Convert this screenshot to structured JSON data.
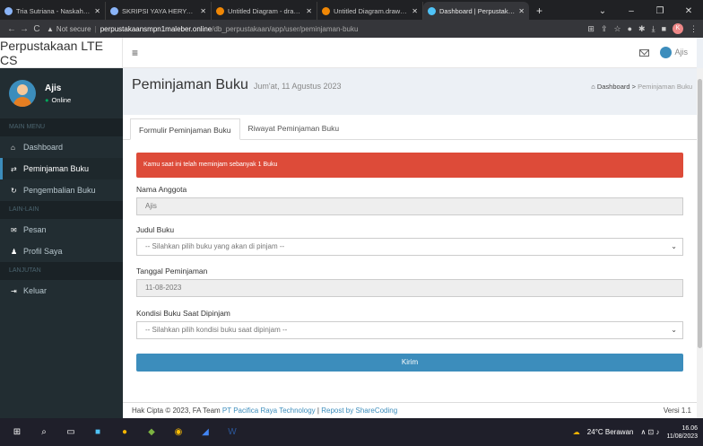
{
  "browser": {
    "tabs": [
      {
        "title": "Tria Sutriana - Naskah Skripsi",
        "favicon_color": "#8ab4f8",
        "active": false
      },
      {
        "title": "SKRIPSI YAYA HERYANA.pdf",
        "favicon_color": "#8ab4f8",
        "active": false
      },
      {
        "title": "Untitled Diagram - draw.io",
        "favicon_color": "#f08705",
        "active": false
      },
      {
        "title": "Untitled Diagram.drawio - di",
        "favicon_color": "#f08705",
        "active": false
      },
      {
        "title": "Dashboard | Perpustakaan SI",
        "favicon_color": "#4fc3f7",
        "active": true
      }
    ],
    "new_tab": "+",
    "address": {
      "security": "Not secure",
      "host": "perpustakaansmpn1maleber.online",
      "path": "/db_perpustakaan/app/user/peminjaman-buku"
    },
    "profile_initial": "K"
  },
  "app": {
    "logo": "Perpustakaan LTE CS",
    "user_name": "Ajis",
    "user_status": "Online"
  },
  "sidebar": {
    "main_header": "MAIN MENU",
    "items": [
      {
        "label": "Dashboard",
        "icon": "home-icon"
      },
      {
        "label": "Peminjaman Buku",
        "icon": "exchange-icon"
      },
      {
        "label": "Pengembalian Buku",
        "icon": "refresh-icon"
      }
    ],
    "other_header": "LAIN-LAIN",
    "other_items": [
      {
        "label": "Pesan",
        "icon": "envelope-icon"
      },
      {
        "label": "Profil Saya",
        "icon": "user-icon"
      }
    ],
    "more_header": "LANJUTAN",
    "more_items": [
      {
        "label": "Keluar",
        "icon": "sign-out-icon"
      }
    ]
  },
  "page": {
    "title": "Peminjaman Buku",
    "subtitle": "Jum'at, 11 Agustus 2023",
    "breadcrumb_home": "Dashboard",
    "breadcrumb_sep": ">",
    "breadcrumb_current": "Peminjaman Buku"
  },
  "form": {
    "tabs": [
      "Formulir Peminjaman Buku",
      "Riwayat Peminjaman Buku"
    ],
    "alert": "Kamu saat ini telah meminjam sebanyak 1 Buku",
    "nama_label": "Nama Anggota",
    "nama_value": "Ajis",
    "judul_label": "Judul Buku",
    "judul_placeholder": "-- Silahkan pilih buku yang akan di pinjam --",
    "tanggal_label": "Tanggal Peminjaman",
    "tanggal_value": "11-08-2023",
    "kondisi_label": "Kondisi Buku Saat Dipinjam",
    "kondisi_placeholder": "-- Silahkan pilih kondisi buku saat dipinjam --",
    "submit": "Kirim"
  },
  "footer": {
    "prefix": "Hak Cipta © 2023, FA Team",
    "company": "PT Pacifica Raya Technology",
    "sep": "|",
    "repost": "Repost by ShareCoding",
    "version": "Versi 1.1"
  },
  "taskbar": {
    "weather": "24°C Berawan",
    "time": "16.06",
    "date": "11/08/2023"
  },
  "colors": {
    "accent": "#3c8dbc",
    "alert": "#dd4b39",
    "sidebar": "#222d32"
  }
}
